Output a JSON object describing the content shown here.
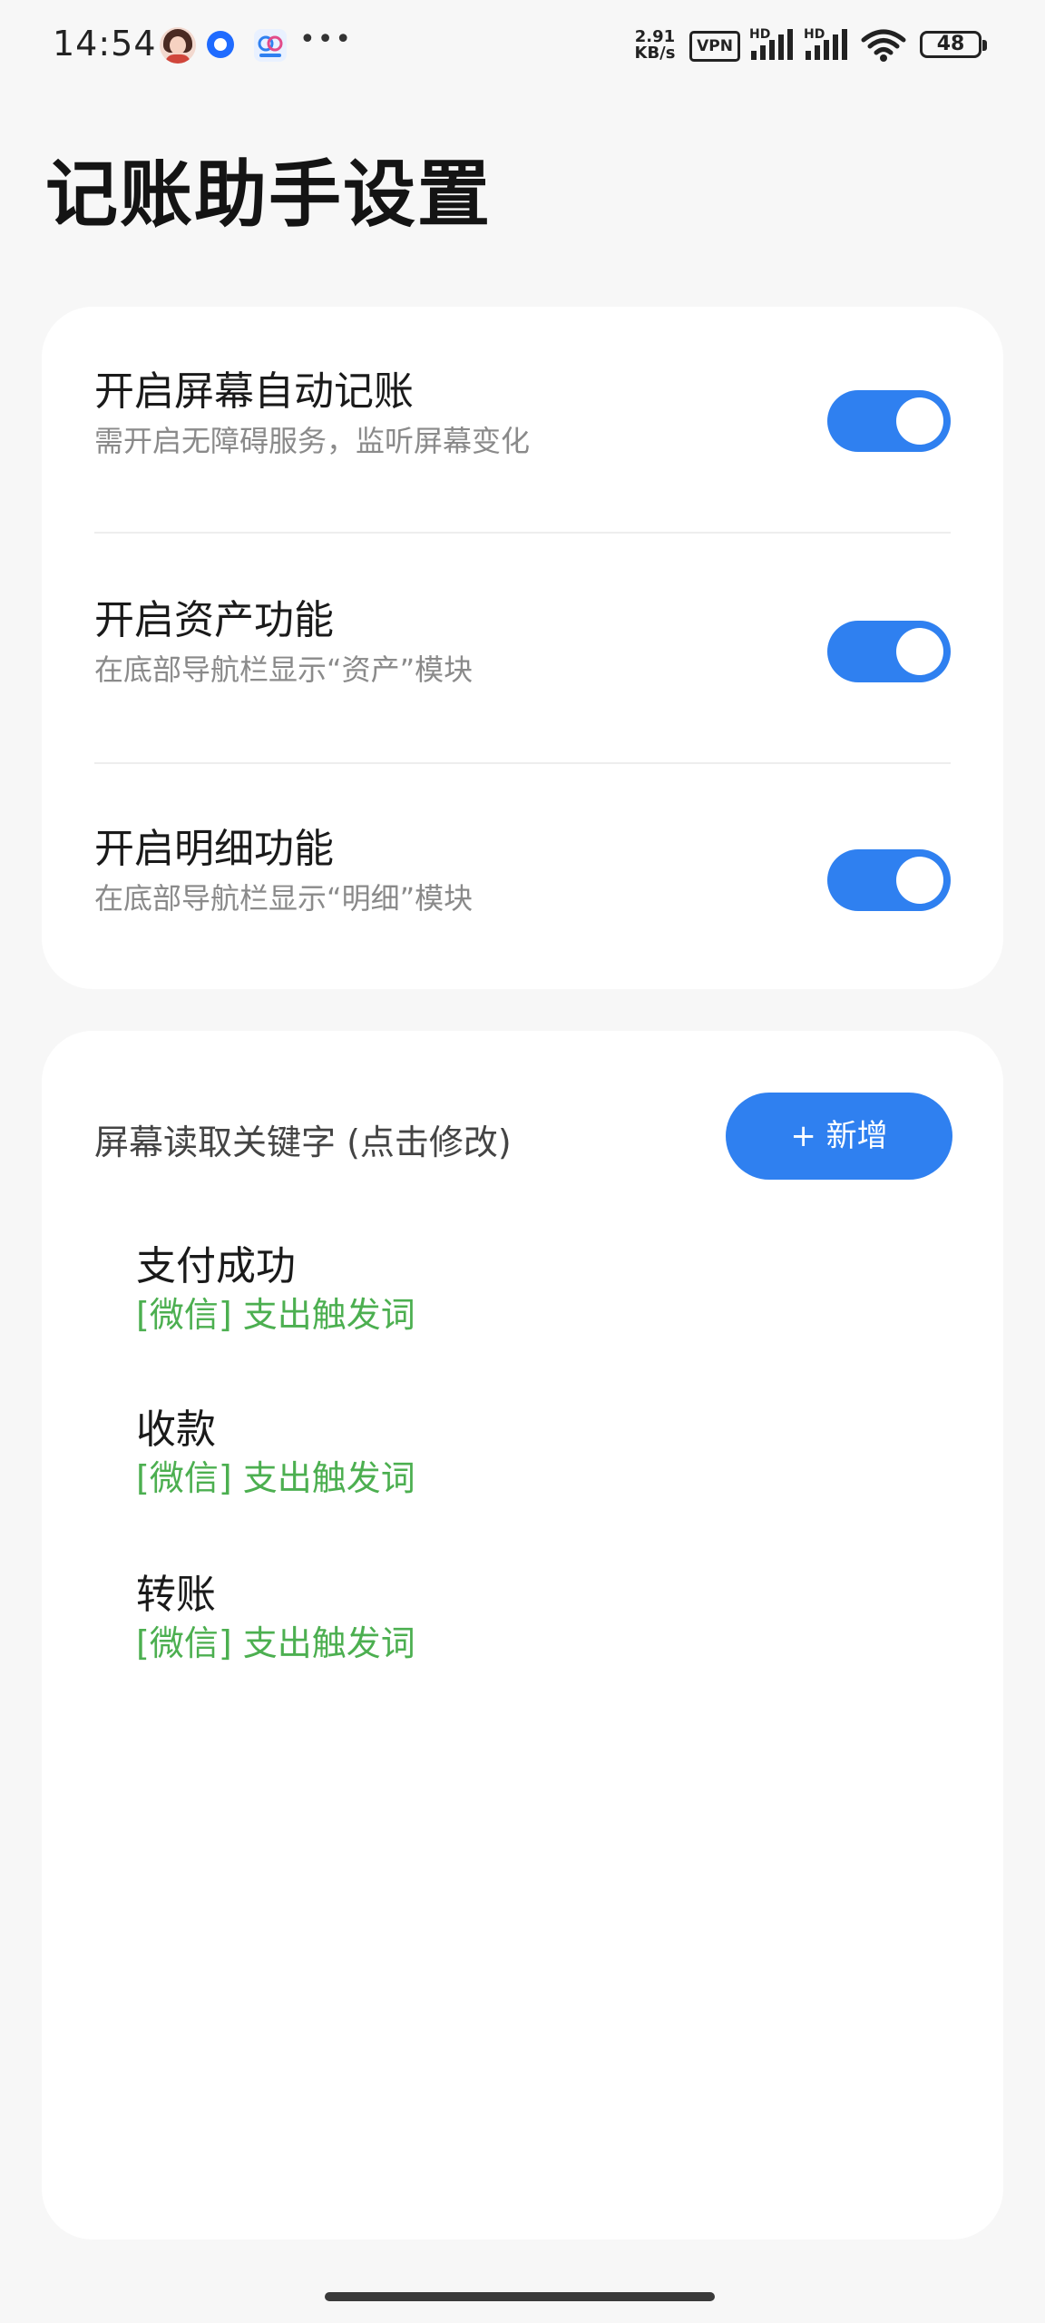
{
  "status_bar": {
    "time": "14:54",
    "net_speed_value": "2.91",
    "net_speed_unit": "KB/s",
    "vpn": "VPN",
    "hd_label": "HD",
    "battery": "48",
    "icons": [
      "avatar-notification-icon",
      "app-notification-icon",
      "cloud-app-notification-icon",
      "more-icon",
      "signal-icon",
      "signal-icon",
      "wifi-icon",
      "battery-icon"
    ]
  },
  "page": {
    "title": "记账助手设置"
  },
  "settings": [
    {
      "title": "开启屏幕自动记账",
      "desc": "需开启无障碍服务，监听屏幕变化",
      "enabled": true
    },
    {
      "title": "开启资产功能",
      "desc": "在底部导航栏显示“资产”模块",
      "enabled": true
    },
    {
      "title": "开启明细功能",
      "desc": "在底部导航栏显示“明细”模块",
      "enabled": true
    }
  ],
  "keywords": {
    "header": "屏幕读取关键字 (点击修改)",
    "add_button": "+ 新增",
    "items": [
      {
        "keyword": "支付成功",
        "source": "[微信]  支出触发词"
      },
      {
        "keyword": "收款",
        "source": "[微信]  支出触发词"
      },
      {
        "keyword": "转账",
        "source": "[微信]  支出触发词"
      }
    ]
  },
  "colors": {
    "accent": "#2f80f0",
    "trigger_text": "#4caf50",
    "background": "#f7f7f7",
    "card": "#ffffff"
  }
}
